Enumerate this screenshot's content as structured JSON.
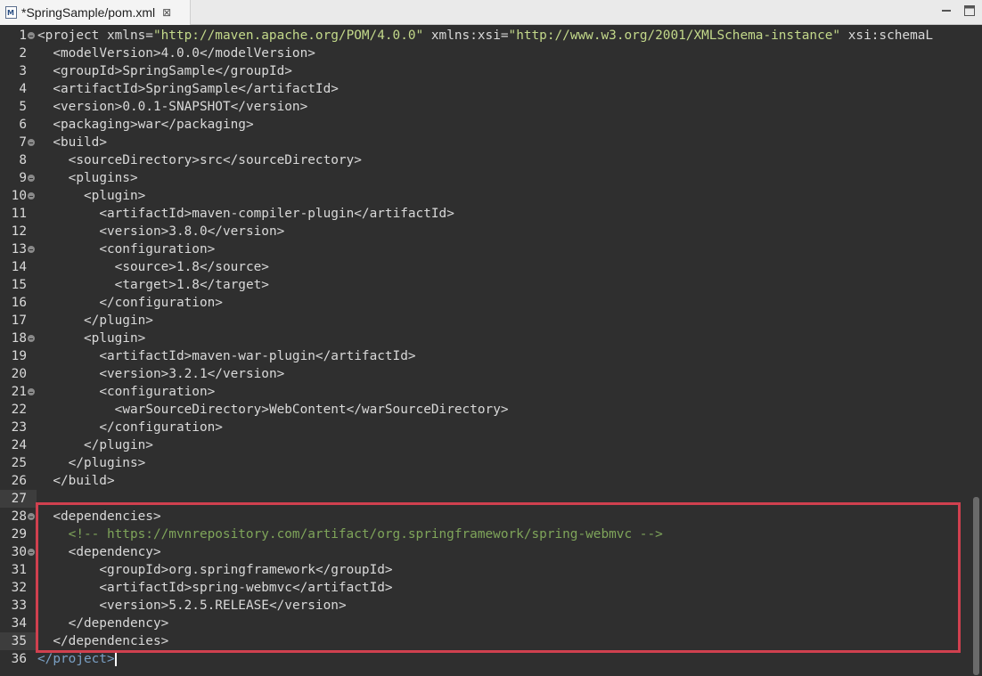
{
  "tab": {
    "title": "*SpringSample/pom.xml",
    "close_glyph": "⊠",
    "icon": "xml-file-icon"
  },
  "window_buttons": {
    "minimize": "minimize-icon",
    "maximize": "maximize-icon"
  },
  "colors": {
    "background": "#2f2f2f",
    "string": "#c3d98a",
    "comment": "#7fa55a",
    "highlight_border": "#d0404f"
  },
  "line_numbers": [
    "1",
    "2",
    "3",
    "4",
    "5",
    "6",
    "7",
    "8",
    "9",
    "10",
    "11",
    "12",
    "13",
    "14",
    "15",
    "16",
    "17",
    "18",
    "19",
    "20",
    "21",
    "22",
    "23",
    "24",
    "25",
    "26",
    "27",
    "28",
    "29",
    "30",
    "31",
    "32",
    "33",
    "34",
    "35",
    "36"
  ],
  "fold_lines": [
    1,
    7,
    9,
    10,
    13,
    18,
    21,
    28,
    30
  ],
  "lines": [
    [
      [
        "t",
        "<"
      ],
      [
        "n",
        "project "
      ],
      [
        "a",
        "xmlns="
      ],
      [
        "s",
        "\"http://maven.apache.org/POM/4.0.0\""
      ],
      [
        "a",
        " xmlns:xsi="
      ],
      [
        "s",
        "\"http://www.w3.org/2001/XMLSchema-instance\""
      ],
      [
        "a",
        " xsi:schemaL"
      ]
    ],
    [
      [
        "x",
        "  "
      ],
      [
        "t",
        "<"
      ],
      [
        "n",
        "modelVersion"
      ],
      [
        "t",
        ">"
      ],
      [
        "x",
        "4.0.0"
      ],
      [
        "t",
        "</"
      ],
      [
        "n",
        "modelVersion"
      ],
      [
        "t",
        ">"
      ]
    ],
    [
      [
        "x",
        "  "
      ],
      [
        "t",
        "<"
      ],
      [
        "n",
        "groupId"
      ],
      [
        "t",
        ">"
      ],
      [
        "x",
        "SpringSample"
      ],
      [
        "t",
        "</"
      ],
      [
        "n",
        "groupId"
      ],
      [
        "t",
        ">"
      ]
    ],
    [
      [
        "x",
        "  "
      ],
      [
        "t",
        "<"
      ],
      [
        "n",
        "artifactId"
      ],
      [
        "t",
        ">"
      ],
      [
        "x",
        "SpringSample"
      ],
      [
        "t",
        "</"
      ],
      [
        "n",
        "artifactId"
      ],
      [
        "t",
        ">"
      ]
    ],
    [
      [
        "x",
        "  "
      ],
      [
        "t",
        "<"
      ],
      [
        "n",
        "version"
      ],
      [
        "t",
        ">"
      ],
      [
        "x",
        "0.0.1-SNAPSHOT"
      ],
      [
        "t",
        "</"
      ],
      [
        "n",
        "version"
      ],
      [
        "t",
        ">"
      ]
    ],
    [
      [
        "x",
        "  "
      ],
      [
        "t",
        "<"
      ],
      [
        "n",
        "packaging"
      ],
      [
        "t",
        ">"
      ],
      [
        "x",
        "war"
      ],
      [
        "t",
        "</"
      ],
      [
        "n",
        "packaging"
      ],
      [
        "t",
        ">"
      ]
    ],
    [
      [
        "x",
        "  "
      ],
      [
        "t",
        "<"
      ],
      [
        "n",
        "build"
      ],
      [
        "t",
        ">"
      ]
    ],
    [
      [
        "x",
        "    "
      ],
      [
        "t",
        "<"
      ],
      [
        "n",
        "sourceDirectory"
      ],
      [
        "t",
        ">"
      ],
      [
        "x",
        "src"
      ],
      [
        "t",
        "</"
      ],
      [
        "n",
        "sourceDirectory"
      ],
      [
        "t",
        ">"
      ]
    ],
    [
      [
        "x",
        "    "
      ],
      [
        "t",
        "<"
      ],
      [
        "n",
        "plugins"
      ],
      [
        "t",
        ">"
      ]
    ],
    [
      [
        "x",
        "      "
      ],
      [
        "t",
        "<"
      ],
      [
        "n",
        "plugin"
      ],
      [
        "t",
        ">"
      ]
    ],
    [
      [
        "x",
        "        "
      ],
      [
        "t",
        "<"
      ],
      [
        "n",
        "artifactId"
      ],
      [
        "t",
        ">"
      ],
      [
        "x",
        "maven-compiler-plugin"
      ],
      [
        "t",
        "</"
      ],
      [
        "n",
        "artifactId"
      ],
      [
        "t",
        ">"
      ]
    ],
    [
      [
        "x",
        "        "
      ],
      [
        "t",
        "<"
      ],
      [
        "n",
        "version"
      ],
      [
        "t",
        ">"
      ],
      [
        "x",
        "3.8.0"
      ],
      [
        "t",
        "</"
      ],
      [
        "n",
        "version"
      ],
      [
        "t",
        ">"
      ]
    ],
    [
      [
        "x",
        "        "
      ],
      [
        "t",
        "<"
      ],
      [
        "n",
        "configuration"
      ],
      [
        "t",
        ">"
      ]
    ],
    [
      [
        "x",
        "          "
      ],
      [
        "t",
        "<"
      ],
      [
        "n",
        "source"
      ],
      [
        "t",
        ">"
      ],
      [
        "x",
        "1.8"
      ],
      [
        "t",
        "</"
      ],
      [
        "n",
        "source"
      ],
      [
        "t",
        ">"
      ]
    ],
    [
      [
        "x",
        "          "
      ],
      [
        "t",
        "<"
      ],
      [
        "n",
        "target"
      ],
      [
        "t",
        ">"
      ],
      [
        "x",
        "1.8"
      ],
      [
        "t",
        "</"
      ],
      [
        "n",
        "target"
      ],
      [
        "t",
        ">"
      ]
    ],
    [
      [
        "x",
        "        "
      ],
      [
        "t",
        "</"
      ],
      [
        "n",
        "configuration"
      ],
      [
        "t",
        ">"
      ]
    ],
    [
      [
        "x",
        "      "
      ],
      [
        "t",
        "</"
      ],
      [
        "n",
        "plugin"
      ],
      [
        "t",
        ">"
      ]
    ],
    [
      [
        "x",
        "      "
      ],
      [
        "t",
        "<"
      ],
      [
        "n",
        "plugin"
      ],
      [
        "t",
        ">"
      ]
    ],
    [
      [
        "x",
        "        "
      ],
      [
        "t",
        "<"
      ],
      [
        "n",
        "artifactId"
      ],
      [
        "t",
        ">"
      ],
      [
        "x",
        "maven-war-plugin"
      ],
      [
        "t",
        "</"
      ],
      [
        "n",
        "artifactId"
      ],
      [
        "t",
        ">"
      ]
    ],
    [
      [
        "x",
        "        "
      ],
      [
        "t",
        "<"
      ],
      [
        "n",
        "version"
      ],
      [
        "t",
        ">"
      ],
      [
        "x",
        "3.2.1"
      ],
      [
        "t",
        "</"
      ],
      [
        "n",
        "version"
      ],
      [
        "t",
        ">"
      ]
    ],
    [
      [
        "x",
        "        "
      ],
      [
        "t",
        "<"
      ],
      [
        "n",
        "configuration"
      ],
      [
        "t",
        ">"
      ]
    ],
    [
      [
        "x",
        "          "
      ],
      [
        "t",
        "<"
      ],
      [
        "n",
        "warSourceDirectory"
      ],
      [
        "t",
        ">"
      ],
      [
        "x",
        "WebContent"
      ],
      [
        "t",
        "</"
      ],
      [
        "n",
        "warSourceDirectory"
      ],
      [
        "t",
        ">"
      ]
    ],
    [
      [
        "x",
        "        "
      ],
      [
        "t",
        "</"
      ],
      [
        "n",
        "configuration"
      ],
      [
        "t",
        ">"
      ]
    ],
    [
      [
        "x",
        "      "
      ],
      [
        "t",
        "</"
      ],
      [
        "n",
        "plugin"
      ],
      [
        "t",
        ">"
      ]
    ],
    [
      [
        "x",
        "    "
      ],
      [
        "t",
        "</"
      ],
      [
        "n",
        "plugins"
      ],
      [
        "t",
        ">"
      ]
    ],
    [
      [
        "x",
        "  "
      ],
      [
        "t",
        "</"
      ],
      [
        "n",
        "build"
      ],
      [
        "t",
        ">"
      ]
    ],
    [],
    [
      [
        "x",
        "  "
      ],
      [
        "t",
        "<"
      ],
      [
        "n",
        "dependencies"
      ],
      [
        "t",
        ">"
      ]
    ],
    [
      [
        "x",
        "    "
      ],
      [
        "c",
        "<!-- https://mvnrepository.com/artifact/org.springframework/spring-webmvc -->"
      ]
    ],
    [
      [
        "x",
        "    "
      ],
      [
        "t",
        "<"
      ],
      [
        "n",
        "dependency"
      ],
      [
        "t",
        ">"
      ]
    ],
    [
      [
        "x",
        "        "
      ],
      [
        "t",
        "<"
      ],
      [
        "n",
        "groupId"
      ],
      [
        "t",
        ">"
      ],
      [
        "x",
        "org.springframework"
      ],
      [
        "t",
        "</"
      ],
      [
        "n",
        "groupId"
      ],
      [
        "t",
        ">"
      ]
    ],
    [
      [
        "x",
        "        "
      ],
      [
        "t",
        "<"
      ],
      [
        "n",
        "artifactId"
      ],
      [
        "t",
        ">"
      ],
      [
        "x",
        "spring-webmvc"
      ],
      [
        "t",
        "</"
      ],
      [
        "n",
        "artifactId"
      ],
      [
        "t",
        ">"
      ]
    ],
    [
      [
        "x",
        "        "
      ],
      [
        "t",
        "<"
      ],
      [
        "n",
        "version"
      ],
      [
        "t",
        ">"
      ],
      [
        "x",
        "5.2.5.RELEASE"
      ],
      [
        "t",
        "</"
      ],
      [
        "n",
        "version"
      ],
      [
        "t",
        ">"
      ]
    ],
    [
      [
        "x",
        "    "
      ],
      [
        "t",
        "</"
      ],
      [
        "n",
        "dependency"
      ],
      [
        "t",
        ">"
      ]
    ],
    [
      [
        "x",
        "  "
      ],
      [
        "t",
        "</"
      ],
      [
        "n",
        "dependencies"
      ],
      [
        "t",
        ">"
      ]
    ],
    [
      [
        "b",
        "</"
      ],
      [
        "b",
        "project"
      ],
      [
        "b",
        ">"
      ]
    ]
  ]
}
